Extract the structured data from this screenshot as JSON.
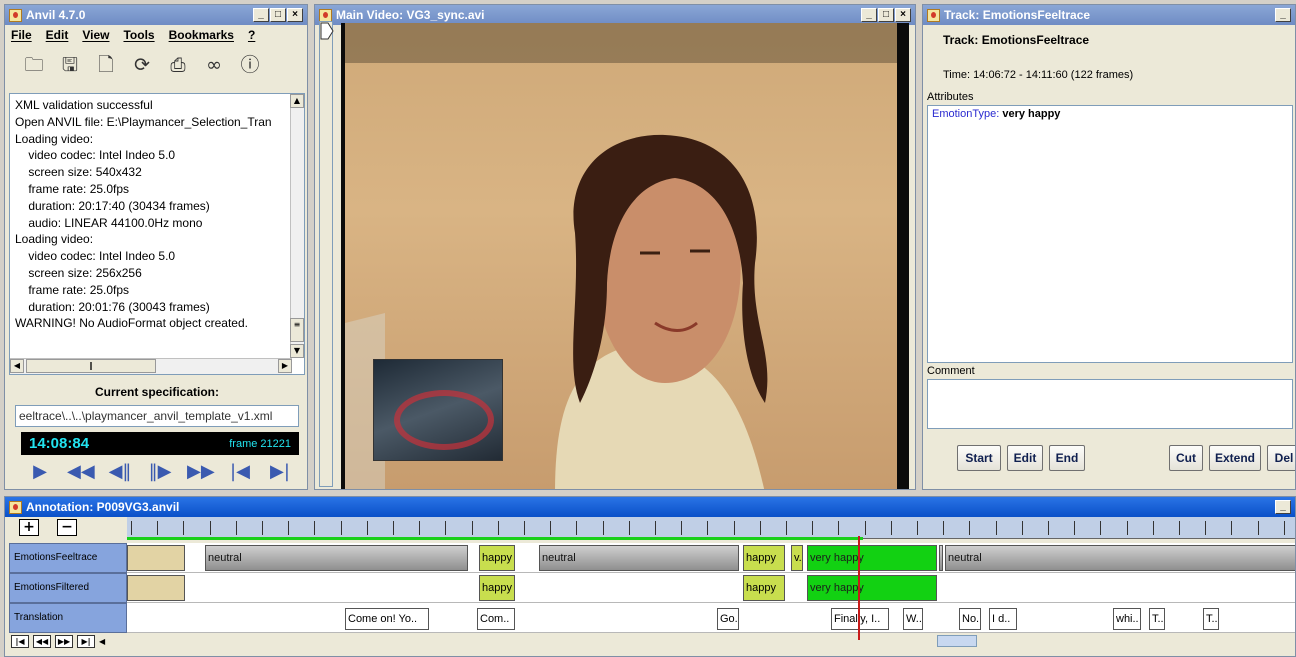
{
  "anvil": {
    "title": "Anvil 4.7.0",
    "menu": [
      "File",
      "Edit",
      "View",
      "Tools",
      "Bookmarks",
      "?"
    ],
    "toolbar_icons": [
      "open-folder-icon",
      "save-icon",
      "new-file-icon",
      "refresh-icon",
      "print-icon",
      "binoculars-icon",
      "info-icon"
    ],
    "log_lines": [
      "XML validation successful",
      "Open ANVIL file: E:\\Playmancer_Selection_Tran",
      "Loading video:",
      "    video codec: Intel Indeo 5.0",
      "    screen size: 540x432",
      "    frame rate: 25.0fps",
      "    duration: 20:17:40 (30434 frames)",
      "    audio: LINEAR 44100.0Hz mono",
      "Loading video:",
      "    video codec: Intel Indeo 5.0",
      "    screen size: 256x256",
      "    frame rate: 25.0fps",
      "    duration: 20:01:76 (30043 frames)",
      "WARNING! No AudioFormat object created."
    ],
    "spec_label": "Current specification:",
    "spec_value": "eeltrace\\..\\..\\playmancer_anvil_template_v1.xml",
    "time": "14:08:84",
    "frame": "frame 21221",
    "player_controls": [
      "play-icon",
      "fast-rewind-icon",
      "step-back-icon",
      "step-forward-icon",
      "fast-forward-icon",
      "go-start-icon",
      "go-end-icon"
    ]
  },
  "video": {
    "title": "Main Video: VG3_sync.avi"
  },
  "track": {
    "window_title": "Track: EmotionsFeeltrace",
    "heading": "Track: EmotionsFeeltrace",
    "time_range": "Time: 14:06:72 - 14:11:60 (122 frames)",
    "attributes_label": "Attributes",
    "attr_key": "EmotionType:",
    "attr_value": "very happy",
    "comment_label": "Comment",
    "buttons": [
      "Start",
      "Edit",
      "End",
      "Cut",
      "Extend",
      "Del"
    ]
  },
  "annotation": {
    "title": "Annotation: P009VG3.anvil",
    "zoom_in": "+",
    "zoom_out": "−",
    "tracks": [
      {
        "name": "EmotionsFeeltrace",
        "elements": [
          {
            "label": "",
            "style": "tan",
            "start": 0,
            "width": 58
          },
          {
            "label": "neutral",
            "style": "grey",
            "start": 78,
            "width": 263
          },
          {
            "label": "happy",
            "style": "lime",
            "start": 352,
            "width": 36
          },
          {
            "label": "neutral",
            "style": "grey",
            "start": 412,
            "width": 200
          },
          {
            "label": "happy",
            "style": "lime",
            "start": 616,
            "width": 42
          },
          {
            "label": "v..",
            "style": "lime",
            "start": 664,
            "width": 12
          },
          {
            "label": "very happy",
            "style": "green",
            "start": 680,
            "width": 130
          },
          {
            "label": "",
            "style": "grey",
            "start": 812,
            "width": 4
          },
          {
            "label": "neutral",
            "style": "grey",
            "start": 818,
            "width": 356
          }
        ]
      },
      {
        "name": "EmotionsFiltered",
        "elements": [
          {
            "label": "",
            "style": "tan",
            "start": 0,
            "width": 58
          },
          {
            "label": "happy",
            "style": "lime",
            "start": 352,
            "width": 36
          },
          {
            "label": "happy",
            "style": "lime",
            "start": 616,
            "width": 42
          },
          {
            "label": "very happy",
            "style": "green",
            "start": 680,
            "width": 130
          }
        ]
      },
      {
        "name": "Translation",
        "elements": [
          {
            "label": "Come on! Yo..",
            "style": "white",
            "start": 218,
            "width": 84
          },
          {
            "label": "Com..",
            "style": "white",
            "start": 350,
            "width": 38
          },
          {
            "label": "Go..",
            "style": "white",
            "start": 590,
            "width": 22
          },
          {
            "label": "Finally, I..",
            "style": "white",
            "start": 704,
            "width": 58
          },
          {
            "label": "W..",
            "style": "white",
            "start": 776,
            "width": 20
          },
          {
            "label": "No..",
            "style": "white",
            "start": 832,
            "width": 22
          },
          {
            "label": "I d..",
            "style": "white",
            "start": 862,
            "width": 28
          },
          {
            "label": "whi..",
            "style": "white",
            "start": 986,
            "width": 28
          },
          {
            "label": "T..",
            "style": "white",
            "start": 1022,
            "width": 16
          },
          {
            "label": "T..",
            "style": "white",
            "start": 1076,
            "width": 16
          }
        ]
      }
    ],
    "nav_buttons": [
      "go-first-icon",
      "page-back-icon",
      "page-forward-icon",
      "go-last-icon"
    ]
  }
}
